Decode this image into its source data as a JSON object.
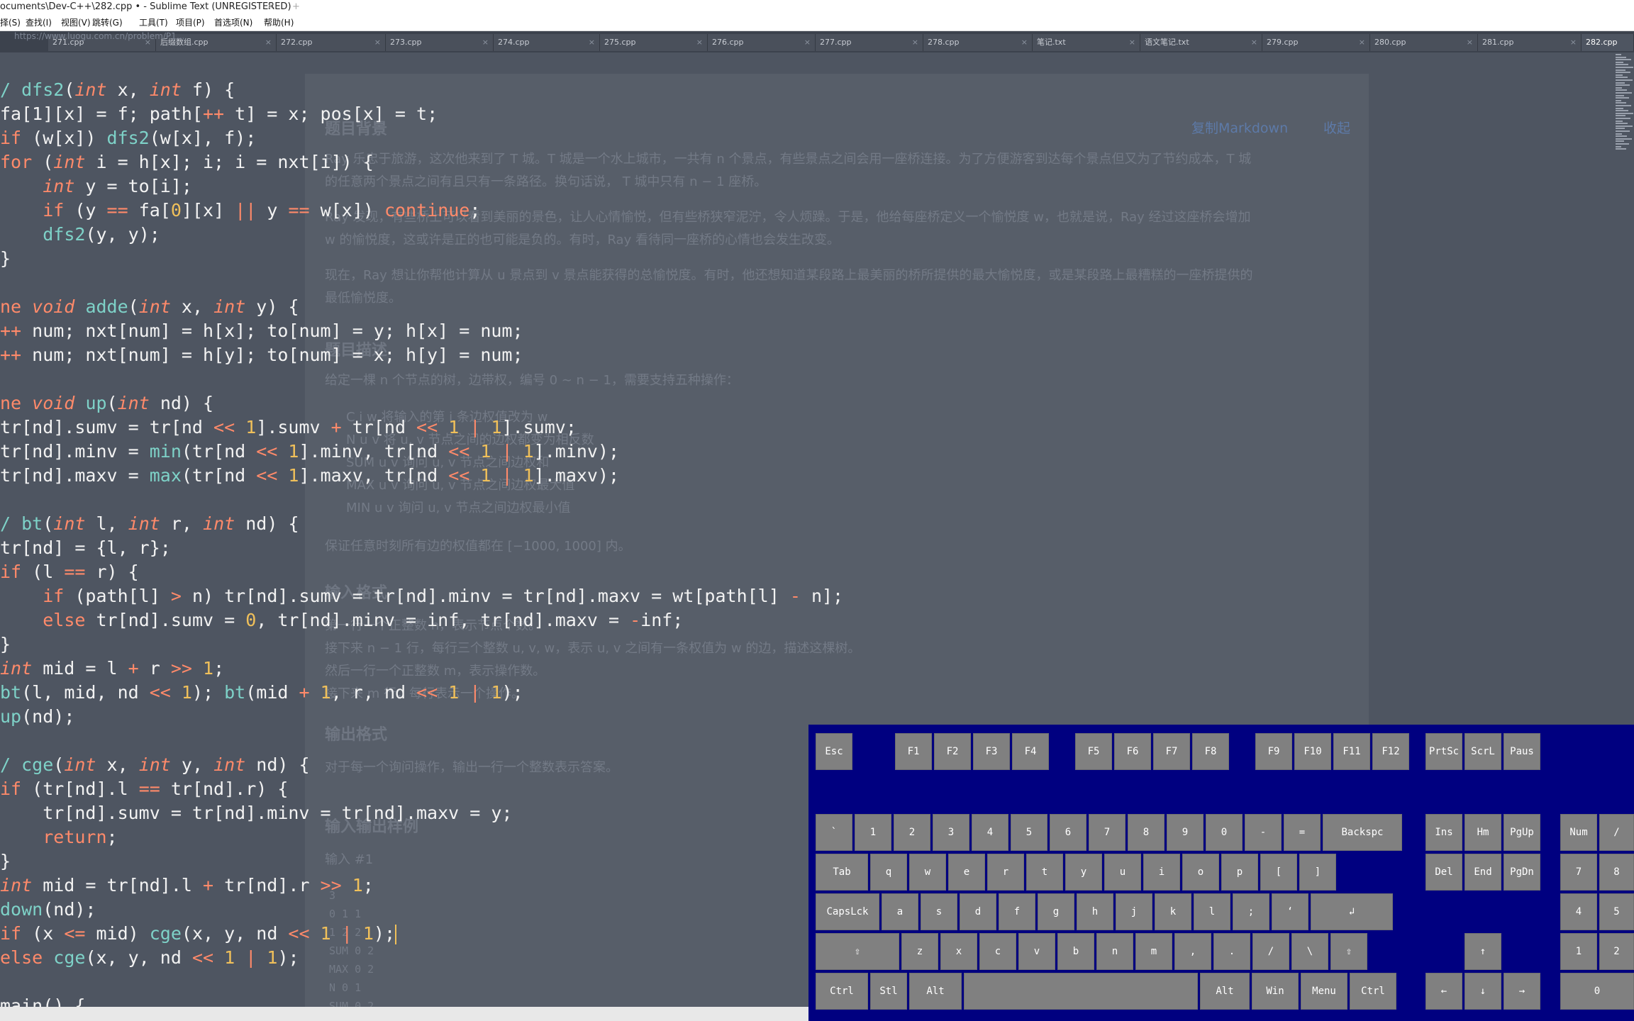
{
  "window": {
    "title": "ocuments\\Dev-C++\\282.cpp • - Sublime Text (UNREGISTERED)",
    "tab_close": "×",
    "tab_add": "+"
  },
  "menu": [
    "择(S)",
    "查找(I)",
    "视图(V)",
    "跳转(G)",
    "工具(T)",
    "项目(P)",
    "首选项(N)",
    "帮助(H)"
  ],
  "url_ghost": "https://www.luogu.com.cn/problem/P1...",
  "tabs": [
    {
      "label": "271.cpp",
      "active": false
    },
    {
      "label": "后缀数组.cpp",
      "active": false
    },
    {
      "label": "272.cpp",
      "active": false
    },
    {
      "label": "273.cpp",
      "active": false
    },
    {
      "label": "274.cpp",
      "active": false
    },
    {
      "label": "275.cpp",
      "active": false
    },
    {
      "label": "276.cpp",
      "active": false
    },
    {
      "label": "277.cpp",
      "active": false
    },
    {
      "label": "278.cpp",
      "active": false
    },
    {
      "label": "笔记.txt",
      "active": false
    },
    {
      "label": "语文笔记.txt",
      "active": false
    },
    {
      "label": "279.cpp",
      "active": false
    },
    {
      "label": "280.cpp",
      "active": false
    },
    {
      "label": "281.cpp",
      "active": false
    },
    {
      "label": "282.cpp",
      "active": true
    }
  ],
  "tab_close_glyph": "×",
  "code_lines": [
    [
      [
        "f",
        "/ dfs2"
      ],
      [
        "p",
        "("
      ],
      [
        "t",
        "int"
      ],
      [
        "v",
        " x, "
      ],
      [
        "t",
        "int"
      ],
      [
        "v",
        " f) {"
      ]
    ],
    [
      [
        "v",
        "fa[1][x] = f; path["
      ],
      [
        "o",
        "++"
      ],
      [
        "v",
        " t] = x; pos[x] = t;"
      ]
    ],
    [
      [
        "k",
        "if"
      ],
      [
        "v",
        " (w[x]) "
      ],
      [
        "f",
        "dfs2"
      ],
      [
        "v",
        "(w[x], f);"
      ]
    ],
    [
      [
        "k",
        "for"
      ],
      [
        "v",
        " ("
      ],
      [
        "t",
        "int"
      ],
      [
        "v",
        " i = h[x]; i; i = nxt[i]) {"
      ]
    ],
    [
      [
        "v",
        "    "
      ],
      [
        "t",
        "int"
      ],
      [
        "v",
        " y = to[i];"
      ]
    ],
    [
      [
        "v",
        "    "
      ],
      [
        "k",
        "if"
      ],
      [
        "v",
        " (y "
      ],
      [
        "o",
        "=="
      ],
      [
        "v",
        " fa["
      ],
      [
        "n",
        "0"
      ],
      [
        "v",
        "][x] "
      ],
      [
        "o",
        "||"
      ],
      [
        "v",
        " y "
      ],
      [
        "o",
        "=="
      ],
      [
        "v",
        " w[x]) "
      ],
      [
        "k",
        "continue"
      ],
      [
        "v",
        ";"
      ]
    ],
    [
      [
        "v",
        "    "
      ],
      [
        "f",
        "dfs2"
      ],
      [
        "v",
        "(y, y);"
      ]
    ],
    [
      [
        "v",
        "}"
      ]
    ],
    [
      [
        "v",
        ""
      ]
    ],
    [
      [
        "k",
        "ne "
      ],
      [
        "t",
        "void"
      ],
      [
        "v",
        " "
      ],
      [
        "f",
        "adde"
      ],
      [
        "v",
        "("
      ],
      [
        "t",
        "int"
      ],
      [
        "v",
        " x, "
      ],
      [
        "t",
        "int"
      ],
      [
        "v",
        " y) {"
      ]
    ],
    [
      [
        "o",
        "++"
      ],
      [
        "v",
        " num; nxt[num] = h[x]; to[num] = y; h[x] = num;"
      ]
    ],
    [
      [
        "o",
        "++"
      ],
      [
        "v",
        " num; nxt[num] = h[y]; to[num] = x; h[y] = num;"
      ]
    ],
    [
      [
        "v",
        ""
      ]
    ],
    [
      [
        "k",
        "ne "
      ],
      [
        "t",
        "void"
      ],
      [
        "v",
        " "
      ],
      [
        "f",
        "up"
      ],
      [
        "v",
        "("
      ],
      [
        "t",
        "int"
      ],
      [
        "v",
        " nd) {"
      ]
    ],
    [
      [
        "v",
        "tr[nd].sumv = tr[nd "
      ],
      [
        "o",
        "<<"
      ],
      [
        "v",
        " "
      ],
      [
        "n",
        "1"
      ],
      [
        "v",
        "].sumv "
      ],
      [
        "o",
        "+"
      ],
      [
        "v",
        " tr[nd "
      ],
      [
        "o",
        "<<"
      ],
      [
        "v",
        " "
      ],
      [
        "n",
        "1"
      ],
      [
        "v",
        " "
      ],
      [
        "o",
        "|"
      ],
      [
        "v",
        " "
      ],
      [
        "n",
        "1"
      ],
      [
        "v",
        "].sumv;"
      ]
    ],
    [
      [
        "v",
        "tr[nd].minv = "
      ],
      [
        "f",
        "min"
      ],
      [
        "v",
        "(tr[nd "
      ],
      [
        "o",
        "<<"
      ],
      [
        "v",
        " "
      ],
      [
        "n",
        "1"
      ],
      [
        "v",
        "].minv, tr[nd "
      ],
      [
        "o",
        "<<"
      ],
      [
        "v",
        " "
      ],
      [
        "n",
        "1"
      ],
      [
        "v",
        " "
      ],
      [
        "o",
        "|"
      ],
      [
        "v",
        " "
      ],
      [
        "n",
        "1"
      ],
      [
        "v",
        "].minv);"
      ]
    ],
    [
      [
        "v",
        "tr[nd].maxv = "
      ],
      [
        "f",
        "max"
      ],
      [
        "v",
        "(tr[nd "
      ],
      [
        "o",
        "<<"
      ],
      [
        "v",
        " "
      ],
      [
        "n",
        "1"
      ],
      [
        "v",
        "].maxv, tr[nd "
      ],
      [
        "o",
        "<<"
      ],
      [
        "v",
        " "
      ],
      [
        "n",
        "1"
      ],
      [
        "v",
        " "
      ],
      [
        "o",
        "|"
      ],
      [
        "v",
        " "
      ],
      [
        "n",
        "1"
      ],
      [
        "v",
        "].maxv);"
      ]
    ],
    [
      [
        "v",
        ""
      ]
    ],
    [
      [
        "f",
        "/ bt"
      ],
      [
        "v",
        "("
      ],
      [
        "t",
        "int"
      ],
      [
        "v",
        " l, "
      ],
      [
        "t",
        "int"
      ],
      [
        "v",
        " r, "
      ],
      [
        "t",
        "int"
      ],
      [
        "v",
        " nd) {"
      ]
    ],
    [
      [
        "v",
        "tr[nd] = {l, r};"
      ]
    ],
    [
      [
        "k",
        "if"
      ],
      [
        "v",
        " (l "
      ],
      [
        "o",
        "=="
      ],
      [
        "v",
        " r) {"
      ]
    ],
    [
      [
        "v",
        "    "
      ],
      [
        "k",
        "if"
      ],
      [
        "v",
        " (path[l] "
      ],
      [
        "o",
        ">"
      ],
      [
        "v",
        " n) tr[nd].sumv = tr[nd].minv = tr[nd].maxv = wt[path[l] "
      ],
      [
        "o",
        "-"
      ],
      [
        "v",
        " n];"
      ]
    ],
    [
      [
        "v",
        "    "
      ],
      [
        "k",
        "else"
      ],
      [
        "v",
        " tr[nd].sumv = "
      ],
      [
        "n",
        "0"
      ],
      [
        "v",
        ", tr[nd].minv = inf, tr[nd].maxv = "
      ],
      [
        "o",
        "-"
      ],
      [
        "v",
        "inf;"
      ]
    ],
    [
      [
        "v",
        "}"
      ]
    ],
    [
      [
        "t",
        "int"
      ],
      [
        "v",
        " mid = l "
      ],
      [
        "o",
        "+"
      ],
      [
        "v",
        " r "
      ],
      [
        "o",
        ">>"
      ],
      [
        "v",
        " "
      ],
      [
        "n",
        "1"
      ],
      [
        "v",
        ";"
      ]
    ],
    [
      [
        "f",
        "bt"
      ],
      [
        "v",
        "(l, mid, nd "
      ],
      [
        "o",
        "<<"
      ],
      [
        "v",
        " "
      ],
      [
        "n",
        "1"
      ],
      [
        "v",
        "); "
      ],
      [
        "f",
        "bt"
      ],
      [
        "v",
        "(mid "
      ],
      [
        "o",
        "+"
      ],
      [
        "v",
        " "
      ],
      [
        "n",
        "1"
      ],
      [
        "v",
        ", r, nd "
      ],
      [
        "o",
        "<<"
      ],
      [
        "v",
        " "
      ],
      [
        "n",
        "1"
      ],
      [
        "v",
        " "
      ],
      [
        "o",
        "|"
      ],
      [
        "v",
        " "
      ],
      [
        "n",
        "1"
      ],
      [
        "v",
        ");"
      ]
    ],
    [
      [
        "f",
        "up"
      ],
      [
        "v",
        "(nd);"
      ]
    ],
    [
      [
        "v",
        ""
      ]
    ],
    [
      [
        "f",
        "/ cge"
      ],
      [
        "v",
        "("
      ],
      [
        "t",
        "int"
      ],
      [
        "v",
        " x, "
      ],
      [
        "t",
        "int"
      ],
      [
        "v",
        " y, "
      ],
      [
        "t",
        "int"
      ],
      [
        "v",
        " nd) {"
      ]
    ],
    [
      [
        "k",
        "if"
      ],
      [
        "v",
        " (tr[nd].l "
      ],
      [
        "o",
        "=="
      ],
      [
        "v",
        " tr[nd].r) {"
      ]
    ],
    [
      [
        "v",
        "    tr[nd].sumv = tr[nd].minv = tr[nd].maxv = y;"
      ]
    ],
    [
      [
        "v",
        "    "
      ],
      [
        "k",
        "return"
      ],
      [
        "v",
        ";"
      ]
    ],
    [
      [
        "v",
        "}"
      ]
    ],
    [
      [
        "t",
        "int"
      ],
      [
        "v",
        " mid = tr[nd].l "
      ],
      [
        "o",
        "+"
      ],
      [
        "v",
        " tr[nd].r "
      ],
      [
        "o",
        ">>"
      ],
      [
        "v",
        " "
      ],
      [
        "n",
        "1"
      ],
      [
        "v",
        ";"
      ]
    ],
    [
      [
        "f",
        "down"
      ],
      [
        "v",
        "(nd);"
      ]
    ],
    [
      [
        "k",
        "if"
      ],
      [
        "v",
        " (x "
      ],
      [
        "o",
        "<="
      ],
      [
        "v",
        " mid) "
      ],
      [
        "f",
        "cge"
      ],
      [
        "v",
        "(x, y, nd "
      ],
      [
        "o",
        "<<"
      ],
      [
        "v",
        " "
      ],
      [
        "n",
        "1"
      ],
      [
        "v",
        " "
      ],
      [
        "o",
        "|"
      ],
      [
        "v",
        " "
      ],
      [
        "n",
        "1"
      ],
      [
        "v",
        ");"
      ],
      [
        "caret",
        ""
      ]
    ],
    [
      [
        "k",
        "else"
      ],
      [
        "v",
        " "
      ],
      [
        "f",
        "cge"
      ],
      [
        "v",
        "(x, y, nd "
      ],
      [
        "o",
        "<<"
      ],
      [
        "v",
        " "
      ],
      [
        "n",
        "1"
      ],
      [
        "v",
        " "
      ],
      [
        "o",
        "|"
      ],
      [
        "v",
        " "
      ],
      [
        "n",
        "1"
      ],
      [
        "v",
        ");"
      ]
    ],
    [
      [
        "v",
        ""
      ]
    ],
    [
      [
        "v",
        "main() {"
      ]
    ]
  ],
  "ghost_page": {
    "copy_markdown": "复制Markdown",
    "collapse": "收起",
    "bg_title": "题目背景",
    "bg_p1": "Ray 乐忠于旅游，这次他来到了 T 城。T 城是一个水上城市，一共有 n 个景点，有些景点之间会用一座桥连接。为了方便游客到达每个景点但又为了节约成本，T 城",
    "bg_p1b": "的任意两个景点之间有且只有一条路径。换句话说， T 城中只有 n − 1 座桥。",
    "bg_p2": "Ray 发现，有些桥上可以看到美丽的景色，让人心情愉悦，但有些桥狭窄泥泞，令人烦躁。于是，他给每座桥定义一个愉悦度 w，也就是说，Ray 经过这座桥会增加",
    "bg_p2b": "w 的愉悦度，这或许是正的也可能是负的。有时，Ray 看待同一座桥的心情也会发生改变。",
    "bg_p3": "现在，Ray 想让你帮他计算从 u 景点到 v 景点能获得的总愉悦度。有时，他还想知道某段路上最美丽的桥所提供的最大愉悦度，或是某段路上最糟糕的一座桥提供的",
    "bg_p3b": "最低愉悦度。",
    "desc_title": "题目描述",
    "desc_p": "给定一棵 n 个节点的树，边带权，编号 0 ∼ n − 1，需要支持五种操作：",
    "ops": [
      "C i w 将输入的第 i 条边权值改为 w",
      "N u v 将 u, v 节点之间的边权都变为相反数",
      "SUM u v 询问 u, v 节点之间边权和",
      "MAX u v 询问 u, v 节点之间边权最大值",
      "MIN u v 询问 u, v 节点之间边权最小值"
    ],
    "guarantee": "保证任意时刻所有边的权值都在 [−1000, 1000] 内。",
    "in_title": "输入格式",
    "in_p1": "第一行一个正整数 n，表示节点个数。",
    "in_p2": "接下来 n − 1 行，每行三个整数 u, v, w，表示 u, v 之间有一条权值为 w 的边，描述这棵树。",
    "in_p3": "然后一行一个正整数 m，表示操作数。",
    "in_p4": "接下来 m 行，每行表示一个操作。",
    "out_title": "输出格式",
    "out_p": "对于每一个询问操作，输出一行一个整数表示答案。",
    "sample_title": "输入输出样例",
    "sample_in": "输入 #1",
    "sample_lines": [
      "3",
      "0 1 1",
      "1 2 2",
      "SUM 0 2",
      "MAX 0 2",
      "N 0 1",
      "SUM 0 2"
    ]
  },
  "keyboard": {
    "row_fn": [
      "Esc",
      "F1",
      "F2",
      "F3",
      "F4",
      "F5",
      "F6",
      "F7",
      "F8",
      "F9",
      "F10",
      "F11",
      "F12",
      "PrtSc",
      "ScrL",
      "Paus"
    ],
    "row_num": [
      "`",
      "1",
      "2",
      "3",
      "4",
      "5",
      "6",
      "7",
      "8",
      "9",
      "0",
      "-",
      "=",
      "Backspc"
    ],
    "row_tab": [
      "Tab",
      "q",
      "w",
      "e",
      "r",
      "t",
      "y",
      "u",
      "i",
      "o",
      "p",
      "[",
      "]"
    ],
    "row_caps": [
      "CapsLck",
      "a",
      "s",
      "d",
      "f",
      "g",
      "h",
      "j",
      "k",
      "l",
      ";",
      "‘",
      "↲"
    ],
    "row_shift": [
      "⇧",
      "z",
      "x",
      "c",
      "v",
      "b",
      "n",
      "m",
      ",",
      ".",
      "/",
      "\\",
      "⇧"
    ],
    "row_ctrl": [
      "Ctrl",
      "Stl",
      "Alt",
      "",
      "Alt",
      "Win",
      "Menu",
      "Ctrl"
    ],
    "nav_top": [
      "Ins",
      "Hm",
      "PgUp"
    ],
    "nav_bot": [
      "Del",
      "End",
      "PgDn"
    ],
    "arrows": [
      "↑",
      "←",
      "↓",
      "→"
    ],
    "numpad": [
      "Num",
      "/",
      "7",
      "8",
      "4",
      "5",
      "1",
      "2",
      "0"
    ]
  },
  "colors": {
    "editor_bg": "#4e5561",
    "keyboard_bg": "#000080",
    "key_bg": "#808080",
    "keyword": "#ff8a6a",
    "function": "#7ed2c8",
    "number": "#f0c05a"
  }
}
